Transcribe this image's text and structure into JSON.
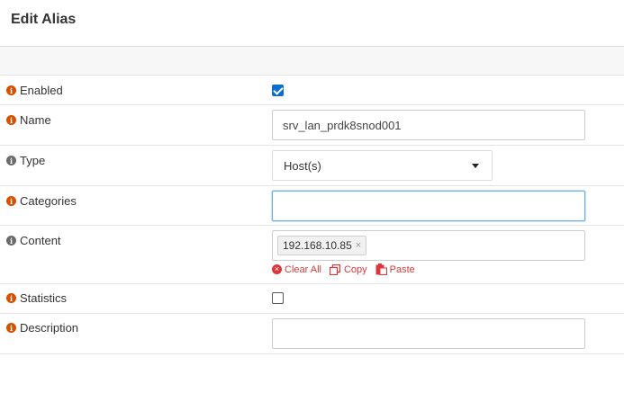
{
  "header": {
    "title": "Edit Alias"
  },
  "form": {
    "enabled": {
      "label": "Enabled",
      "checked": true
    },
    "name": {
      "label": "Name",
      "value": "srv_lan_prdk8snod001"
    },
    "type": {
      "label": "Type",
      "selected": "Host(s)"
    },
    "categories": {
      "label": "Categories",
      "value": ""
    },
    "content": {
      "label": "Content",
      "tokens": [
        {
          "text": "192.168.10.85",
          "remove": "×"
        }
      ],
      "actions": {
        "clear_all": "Clear All",
        "copy": "Copy",
        "paste": "Paste"
      }
    },
    "statistics": {
      "label": "Statistics",
      "checked": false
    },
    "description": {
      "label": "Description",
      "value": ""
    }
  },
  "icons": {
    "info": "i",
    "clear": "×",
    "copy": "copy-icon",
    "paste": "paste-icon"
  },
  "colors": {
    "info_orange": "#d94f00",
    "info_gray": "#6b6b6b",
    "checkbox_blue": "#0a6ed1",
    "action_red": "#d9383a",
    "focus_border": "#66afe9"
  }
}
